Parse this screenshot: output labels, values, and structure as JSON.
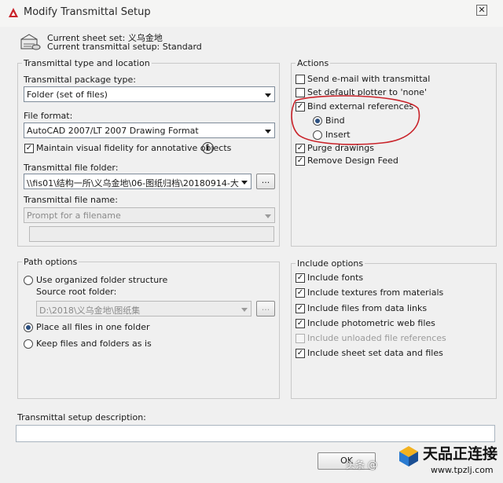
{
  "window": {
    "title": "Modify Transmittal Setup",
    "close_glyph": "✕"
  },
  "header": {
    "current_sheet_set": "Current sheet set: 义乌金地",
    "current_setup": "Current transmittal setup: Standard"
  },
  "type_location": {
    "legend": "Transmittal type and location",
    "package_type_label": "Transmittal package type:",
    "package_type_value": "Folder (set of files)",
    "file_format_label": "File format:",
    "file_format_value": "AutoCAD 2007/LT 2007 Drawing Format",
    "maintain_fidelity_label": "Maintain visual fidelity for annotative objects",
    "maintain_fidelity_checked": true,
    "info_glyph": "i",
    "folder_label": "Transmittal file folder:",
    "folder_value": "\\\\fis01\\结构一所\\义乌金地\\06-图纸归档\\20180914-大",
    "browse_label": "...",
    "filename_label": "Transmittal file name:",
    "filename_value": "Prompt for a filename"
  },
  "actions": {
    "legend": "Actions",
    "send_email": {
      "label": "Send e-mail with transmittal",
      "checked": false
    },
    "default_plotter": {
      "label": "Set default plotter to 'none'",
      "checked": false
    },
    "bind_xrefs": {
      "label": "Bind external references",
      "checked": true
    },
    "bind": {
      "label": "Bind",
      "selected": true
    },
    "insert": {
      "label": "Insert",
      "selected": false
    },
    "purge": {
      "label": "Purge drawings",
      "checked": true
    },
    "remove_design_feed": {
      "label": "Remove Design Feed",
      "checked": true
    }
  },
  "path_options": {
    "legend": "Path options",
    "use_organized": {
      "label": "Use organized folder structure",
      "selected": false
    },
    "source_root_label": "Source root folder:",
    "source_root_value": "D:\\2018\\义乌金地\\图纸集",
    "browse_label": "...",
    "place_all": {
      "label": "Place all files in one folder",
      "selected": true
    },
    "keep_files": {
      "label": "Keep files and folders as is",
      "selected": false
    }
  },
  "include_options": {
    "legend": "Include options",
    "items": [
      {
        "label": "Include fonts",
        "checked": true,
        "disabled": false
      },
      {
        "label": "Include textures from materials",
        "checked": true,
        "disabled": false
      },
      {
        "label": "Include files from data links",
        "checked": true,
        "disabled": false
      },
      {
        "label": "Include photometric web files",
        "checked": true,
        "disabled": false
      },
      {
        "label": "Include unloaded file references",
        "checked": false,
        "disabled": true
      },
      {
        "label": "Include sheet set data and files",
        "checked": true,
        "disabled": false
      }
    ]
  },
  "description": {
    "label": "Transmittal setup description:",
    "value": ""
  },
  "buttons": {
    "ok": "OK"
  },
  "watermark": {
    "brand": "天品正连接",
    "url": "www.tpzlj.com",
    "source": "头条 @"
  },
  "colors": {
    "annotation_red": "#c9232a",
    "radio_dot": "#2b4f80"
  },
  "check_glyph": "✓"
}
